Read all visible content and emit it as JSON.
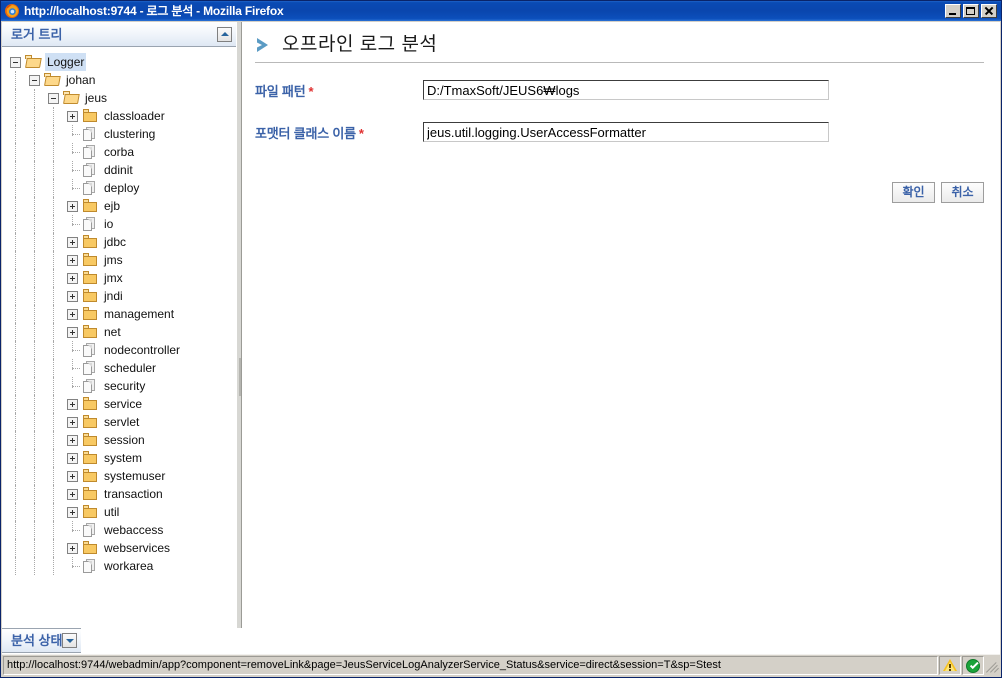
{
  "window": {
    "title": "http://localhost:9744 - 로그 분석 - Mozilla Firefox",
    "app_icon": "firefox-icon",
    "minimize_label": "",
    "maximize_label": "",
    "close_label": ""
  },
  "left_panel": {
    "header_title": "로거 트리",
    "collapse_icon": "triangle-up-icon",
    "tree": [
      {
        "label": "Logger",
        "depth": 0,
        "toggle": "minus",
        "icon": "folder-open-icon",
        "selected": true
      },
      {
        "label": "johan",
        "depth": 1,
        "toggle": "minus",
        "icon": "folder-open-icon",
        "selected": false
      },
      {
        "label": "jeus",
        "depth": 2,
        "toggle": "minus",
        "icon": "folder-open-icon",
        "selected": false
      },
      {
        "label": "classloader",
        "depth": 3,
        "toggle": "plus",
        "icon": "folder-icon",
        "selected": false
      },
      {
        "label": "clustering",
        "depth": 3,
        "toggle": "none",
        "icon": "document-icon",
        "selected": false
      },
      {
        "label": "corba",
        "depth": 3,
        "toggle": "none",
        "icon": "document-icon",
        "selected": false
      },
      {
        "label": "ddinit",
        "depth": 3,
        "toggle": "none",
        "icon": "document-icon",
        "selected": false
      },
      {
        "label": "deploy",
        "depth": 3,
        "toggle": "none",
        "icon": "document-icon",
        "selected": false
      },
      {
        "label": "ejb",
        "depth": 3,
        "toggle": "plus",
        "icon": "folder-icon",
        "selected": false
      },
      {
        "label": "io",
        "depth": 3,
        "toggle": "none",
        "icon": "document-icon",
        "selected": false
      },
      {
        "label": "jdbc",
        "depth": 3,
        "toggle": "plus",
        "icon": "folder-icon",
        "selected": false
      },
      {
        "label": "jms",
        "depth": 3,
        "toggle": "plus",
        "icon": "folder-icon",
        "selected": false
      },
      {
        "label": "jmx",
        "depth": 3,
        "toggle": "plus",
        "icon": "folder-icon",
        "selected": false
      },
      {
        "label": "jndi",
        "depth": 3,
        "toggle": "plus",
        "icon": "folder-icon",
        "selected": false
      },
      {
        "label": "management",
        "depth": 3,
        "toggle": "plus",
        "icon": "folder-icon",
        "selected": false
      },
      {
        "label": "net",
        "depth": 3,
        "toggle": "plus",
        "icon": "folder-icon",
        "selected": false
      },
      {
        "label": "nodecontroller",
        "depth": 3,
        "toggle": "none",
        "icon": "document-icon",
        "selected": false
      },
      {
        "label": "scheduler",
        "depth": 3,
        "toggle": "none",
        "icon": "document-icon",
        "selected": false
      },
      {
        "label": "security",
        "depth": 3,
        "toggle": "none",
        "icon": "document-icon",
        "selected": false
      },
      {
        "label": "service",
        "depth": 3,
        "toggle": "plus",
        "icon": "folder-icon",
        "selected": false
      },
      {
        "label": "servlet",
        "depth": 3,
        "toggle": "plus",
        "icon": "folder-icon",
        "selected": false
      },
      {
        "label": "session",
        "depth": 3,
        "toggle": "plus",
        "icon": "folder-icon",
        "selected": false
      },
      {
        "label": "system",
        "depth": 3,
        "toggle": "plus",
        "icon": "folder-icon",
        "selected": false
      },
      {
        "label": "systemuser",
        "depth": 3,
        "toggle": "plus",
        "icon": "folder-icon",
        "selected": false
      },
      {
        "label": "transaction",
        "depth": 3,
        "toggle": "plus",
        "icon": "folder-icon",
        "selected": false
      },
      {
        "label": "util",
        "depth": 3,
        "toggle": "plus",
        "icon": "folder-icon",
        "selected": false
      },
      {
        "label": "webaccess",
        "depth": 3,
        "toggle": "none",
        "icon": "document-icon",
        "selected": false
      },
      {
        "label": "webservices",
        "depth": 3,
        "toggle": "plus",
        "icon": "folder-icon",
        "selected": false
      },
      {
        "label": "workarea",
        "depth": 3,
        "toggle": "none",
        "icon": "document-icon",
        "selected": false
      }
    ]
  },
  "bottom_panel": {
    "header_title": "분석 상태",
    "expand_icon": "triangle-down-icon"
  },
  "main": {
    "chevron_icon": "chevron-right-icon",
    "page_title": "오프라인 로그 분석",
    "fields": [
      {
        "label": "파일 패턴",
        "required_marker": "*",
        "value": "D:/TmaxSoft/JEUS6₩logs",
        "placeholder": ""
      },
      {
        "label": "포맷터 클래스 이름",
        "required_marker": "*",
        "value": "jeus.util.logging.UserAccessFormatter",
        "placeholder": ""
      }
    ],
    "buttons": {
      "confirm_label": "확인",
      "cancel_label": "취소"
    }
  },
  "statusbar": {
    "url": "http://localhost:9744/webadmin/app?component=removeLink&page=JeusServiceLogAnalyzerService_Status&service=direct&session=T&sp=Stest",
    "warning_icon": "warning-triangle-icon",
    "security_icon": "green-check-icon",
    "resize_grip": "resize-grip-icon"
  },
  "colors": {
    "titlebar": "#0a46ae",
    "accent_blue": "#3b62a8",
    "chevron": "#5b9bc4",
    "required": "#e03030",
    "folder": "#f8c963",
    "selection": "#cfe0f4"
  }
}
